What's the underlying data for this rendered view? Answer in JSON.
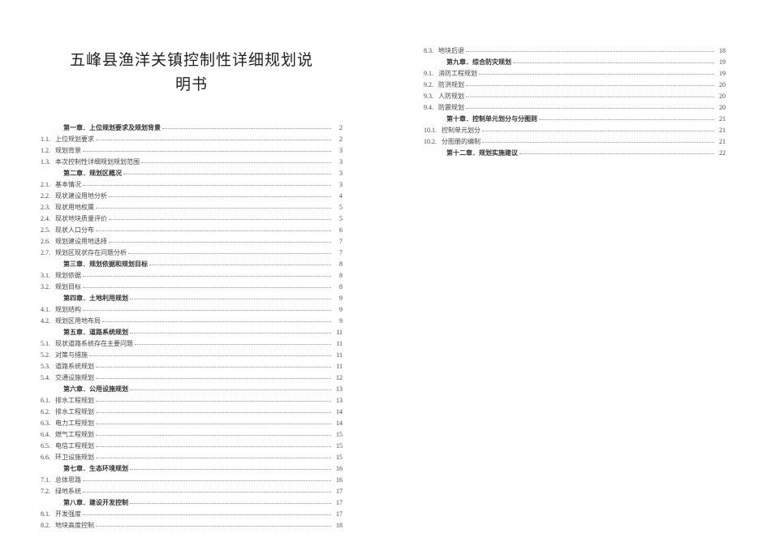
{
  "title": "五峰县渔洋关镇控制性详细规划说明书",
  "toc_left": [
    {
      "type": "chapter",
      "num": "",
      "label": "第一章．上位规划要求及规划背景",
      "page": "2"
    },
    {
      "type": "section",
      "num": "1.1.",
      "label": "上位规划要求",
      "page": "2"
    },
    {
      "type": "section",
      "num": "1.2.",
      "label": "规划背景",
      "page": "3"
    },
    {
      "type": "section",
      "num": "1.3.",
      "label": "本次控制性详细规划规划范围",
      "page": "3"
    },
    {
      "type": "chapter",
      "num": "",
      "label": "第二章．规划区概况",
      "page": "3"
    },
    {
      "type": "section",
      "num": "2.1.",
      "label": "基本情况",
      "page": "3"
    },
    {
      "type": "section",
      "num": "2.2.",
      "label": "现状建设用地分析",
      "page": "4"
    },
    {
      "type": "section",
      "num": "2.3.",
      "label": "现状用地权属",
      "page": "5"
    },
    {
      "type": "section",
      "num": "2.4.",
      "label": "现状地块质量评价",
      "page": "5"
    },
    {
      "type": "section",
      "num": "2.5.",
      "label": "现状人口分布",
      "page": "6"
    },
    {
      "type": "section",
      "num": "2.6.",
      "label": "规划建设用地选择",
      "page": "7"
    },
    {
      "type": "section",
      "num": "2.7.",
      "label": "规划区现状存在问题分析",
      "page": "7"
    },
    {
      "type": "chapter",
      "num": "",
      "label": "第三章．规划依据和规划目标",
      "page": "8"
    },
    {
      "type": "section",
      "num": "3.1.",
      "label": "规划依据",
      "page": "8"
    },
    {
      "type": "section",
      "num": "3.2.",
      "label": "规划目标",
      "page": "8"
    },
    {
      "type": "chapter",
      "num": "",
      "label": "第四章．土地利用规划",
      "page": "9"
    },
    {
      "type": "section",
      "num": "4.1.",
      "label": "规划结构",
      "page": "9"
    },
    {
      "type": "section",
      "num": "4.2.",
      "label": "规划区用地布局",
      "page": "9"
    },
    {
      "type": "chapter",
      "num": "",
      "label": "第五章．道路系统规划",
      "page": "11"
    },
    {
      "type": "section",
      "num": "5.1.",
      "label": "现状道路系统存在主要问题",
      "page": "11"
    },
    {
      "type": "section",
      "num": "5.2.",
      "label": "对策与措施",
      "page": "11"
    },
    {
      "type": "section",
      "num": "5.3.",
      "label": "道路系统规划",
      "page": "11"
    },
    {
      "type": "section",
      "num": "5.4.",
      "label": "交通设施规划",
      "page": "12"
    },
    {
      "type": "chapter",
      "num": "",
      "label": "第六章．公用设施规划",
      "page": "13"
    },
    {
      "type": "section",
      "num": "6.1.",
      "label": "排水工程规划",
      "page": "13"
    },
    {
      "type": "section",
      "num": "6.2.",
      "label": "排水工程规划",
      "page": "14"
    },
    {
      "type": "section",
      "num": "6.3.",
      "label": "电力工程规划",
      "page": "14"
    },
    {
      "type": "section",
      "num": "6.4.",
      "label": "燃气工程规划",
      "page": "15"
    },
    {
      "type": "section",
      "num": "6.5.",
      "label": "电信工程规划",
      "page": "15"
    },
    {
      "type": "section",
      "num": "6.6.",
      "label": "环卫设施规划",
      "page": "15"
    },
    {
      "type": "chapter",
      "num": "",
      "label": "第七章．生态环境规划",
      "page": "16"
    },
    {
      "type": "section",
      "num": "7.1.",
      "label": "总体思路",
      "page": "16"
    },
    {
      "type": "section",
      "num": "7.2.",
      "label": "绿地系统",
      "page": "17"
    },
    {
      "type": "chapter",
      "num": "",
      "label": "第八章．建设开发控制",
      "page": "17"
    },
    {
      "type": "section",
      "num": "8.1.",
      "label": "开发强度",
      "page": "17"
    },
    {
      "type": "section",
      "num": "8.2.",
      "label": "地块高度控制",
      "page": "18"
    }
  ],
  "toc_right": [
    {
      "type": "section",
      "num": "8.3.",
      "label": "地块后退",
      "page": "18"
    },
    {
      "type": "chapter",
      "num": "",
      "label": "第九章．综合防灾规划",
      "page": "19"
    },
    {
      "type": "section",
      "num": "9.1.",
      "label": "消防工程规划",
      "page": "19"
    },
    {
      "type": "section",
      "num": "9.2.",
      "label": "防洪规划",
      "page": "20"
    },
    {
      "type": "section",
      "num": "9.3.",
      "label": "人防规划",
      "page": "20"
    },
    {
      "type": "section",
      "num": "9.4.",
      "label": "防震规划",
      "page": "20"
    },
    {
      "type": "chapter",
      "num": "",
      "label": "第十章．控制单元划分与分图则",
      "page": "21"
    },
    {
      "type": "section",
      "num": "10.1.",
      "label": "控制单元划分",
      "page": "21"
    },
    {
      "type": "section",
      "num": "10.2.",
      "label": "分图册的编制",
      "page": "21"
    },
    {
      "type": "chapter",
      "num": "",
      "label": "第十二章．规划实施建议",
      "page": "22"
    }
  ]
}
